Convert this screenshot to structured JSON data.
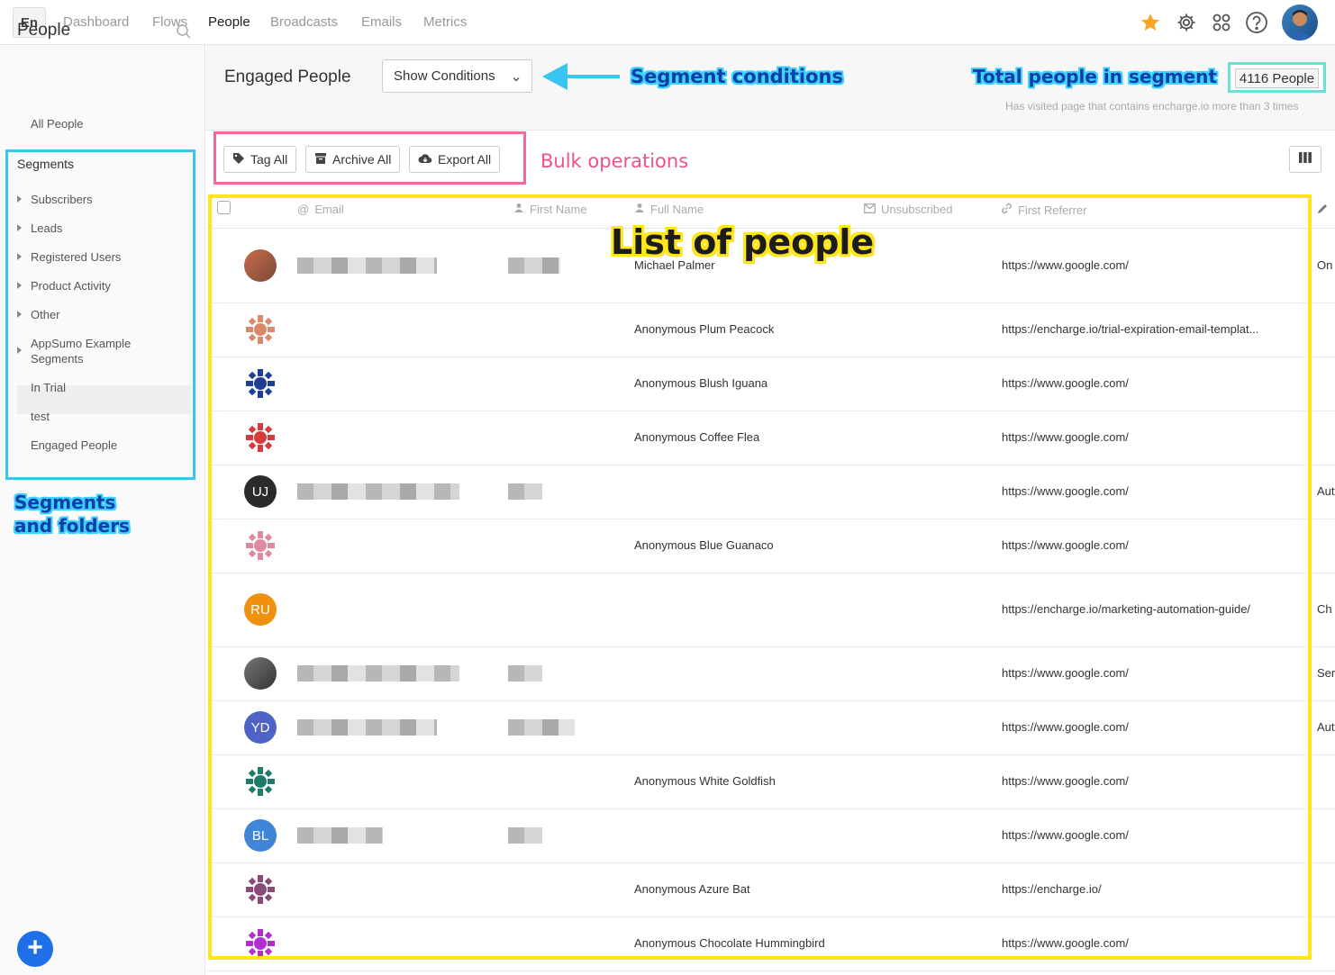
{
  "nav": {
    "logo": "En",
    "links": [
      "Dashboard",
      "Flows",
      "People",
      "Broadcasts",
      "Emails",
      "Metrics"
    ],
    "active": "People"
  },
  "sidebar": {
    "title": "People",
    "all_people": "All People",
    "segments_heading": "Segments",
    "folders": [
      "Subscribers",
      "Leads",
      "Registered Users",
      "Product Activity",
      "Other"
    ],
    "appsumo": "AppSumo Example Segments",
    "segments": [
      "In Trial",
      "test",
      "Engaged People"
    ],
    "active": "Engaged People"
  },
  "header": {
    "title": "Engaged People",
    "show_conditions": "Show Conditions",
    "count": "4116 People",
    "condition_summary": "Has visited page that contains encharge.io more than 3 times"
  },
  "bulk": {
    "tag_all": "Tag All",
    "archive_all": "Archive All",
    "export_all": "Export All"
  },
  "annotations": {
    "segment_conditions": "Segment conditions",
    "total_people": "Total people in segment",
    "bulk_operations": "Bulk operations",
    "list_of_people": "List of people",
    "segments_and_folders_1": "Segments",
    "segments_and_folders_2": "and folders"
  },
  "table": {
    "columns": [
      "Email",
      "First Name",
      "Full Name",
      "Unsubscribed",
      "First Referrer"
    ],
    "rows": [
      {
        "avatar": "",
        "full_name": "Michael Palmer",
        "referrer": "https://www.google.com/",
        "extra": "On"
      },
      {
        "avatar": "",
        "full_name": "Anonymous Plum Peacock",
        "referrer": "https://encharge.io/trial-expiration-email-templat...",
        "extra": ""
      },
      {
        "avatar": "",
        "full_name": "Anonymous Blush Iguana",
        "referrer": "https://www.google.com/",
        "extra": ""
      },
      {
        "avatar": "",
        "full_name": "Anonymous Coffee Flea",
        "referrer": "https://www.google.com/",
        "extra": ""
      },
      {
        "avatar": "UJ",
        "full_name": "",
        "referrer": "https://www.google.com/",
        "extra": "Aut"
      },
      {
        "avatar": "",
        "full_name": "Anonymous Blue Guanaco",
        "referrer": "https://www.google.com/",
        "extra": ""
      },
      {
        "avatar": "RU",
        "full_name": "",
        "referrer": "https://encharge.io/marketing-automation-guide/",
        "extra": "Ch"
      },
      {
        "avatar": "",
        "full_name": "",
        "referrer": "https://www.google.com/",
        "extra": "Ser"
      },
      {
        "avatar": "YD",
        "full_name": "",
        "referrer": "https://www.google.com/",
        "extra": "Aut"
      },
      {
        "avatar": "",
        "full_name": "Anonymous White Goldfish",
        "referrer": "https://www.google.com/",
        "extra": ""
      },
      {
        "avatar": "BL",
        "full_name": "",
        "referrer": "https://www.google.com/",
        "extra": ""
      },
      {
        "avatar": "",
        "full_name": "Anonymous Azure Bat",
        "referrer": "https://encharge.io/",
        "extra": ""
      },
      {
        "avatar": "",
        "full_name": "Anonymous Chocolate Hummingbird",
        "referrer": "https://www.google.com/",
        "extra": ""
      }
    ]
  },
  "colors": {
    "annotation_blue": "#38c5f0",
    "annotation_pink": "#f06a9a",
    "annotation_yellow": "#ffe61a",
    "annotation_teal": "#6de0d6",
    "add_button": "#1e6fe8"
  }
}
